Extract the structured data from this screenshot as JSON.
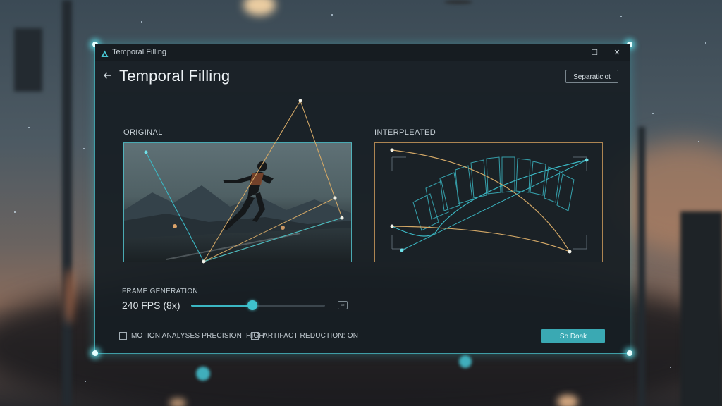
{
  "window": {
    "titlebar_text": "Temporal Filling",
    "maximize_glyph": "☐",
    "close_glyph": "✕"
  },
  "header": {
    "back_glyph": "←",
    "title": "Temporal Filling",
    "button_label": "Separaticiot"
  },
  "panels": {
    "original_label": "ORIGINAL",
    "interpolated_label": "INTERPLEATED"
  },
  "frame_generation": {
    "label": "FRAME GENERATION",
    "value": "240 FPS (8x)",
    "slider_fraction": 0.46,
    "box_text": "▭"
  },
  "options": {
    "motion_label": "MOTION ANALYSES PRECISION: HIGH",
    "artifact_label": "ARTIFACT REDUCTION: ON"
  },
  "primary_button": {
    "label": "So Doak"
  },
  "colors": {
    "accent": "#3aa9b3",
    "teal_line": "#3bb7c3",
    "gold_line": "#d2a766"
  },
  "icons": {
    "app": "app-logo-icon",
    "back": "arrow-left-icon",
    "maximize": "maximize-icon",
    "close": "close-icon"
  }
}
